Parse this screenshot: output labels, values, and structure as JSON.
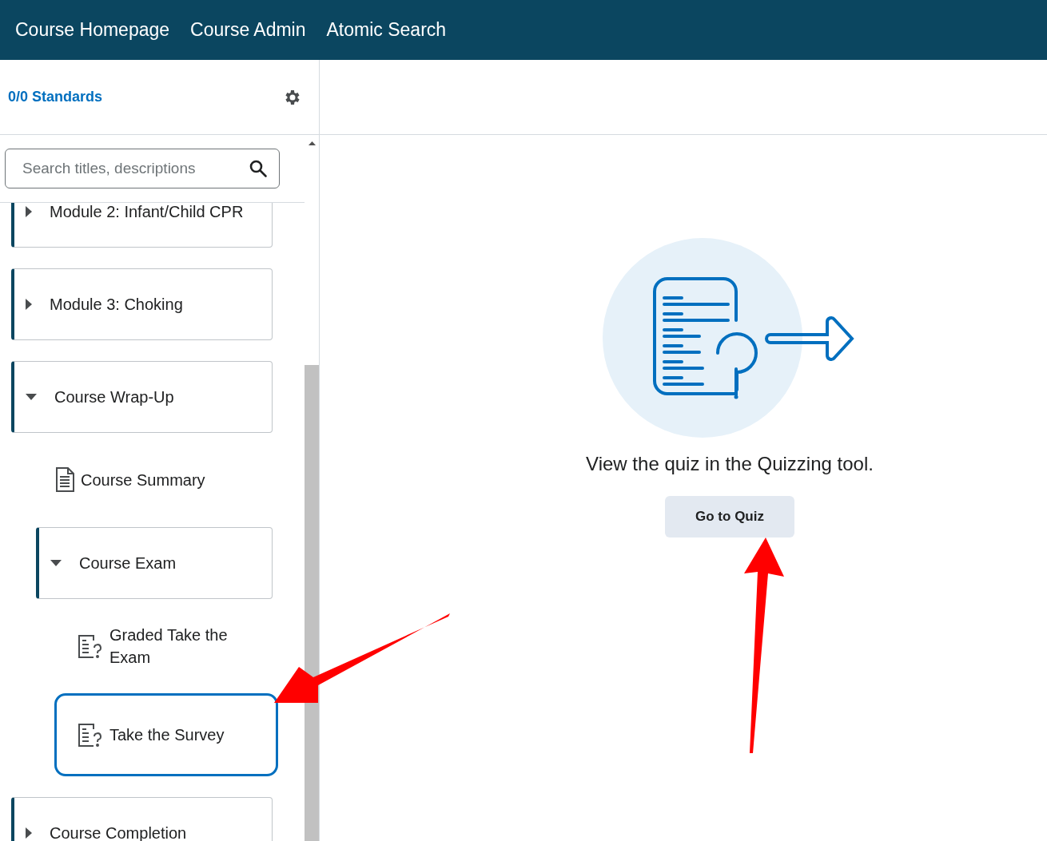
{
  "nav": [
    {
      "label": "Course Homepage"
    },
    {
      "label": "Course Admin"
    },
    {
      "label": "Atomic Search"
    }
  ],
  "sidebar": {
    "standards_link": "0/0 Standards",
    "search": {
      "placeholder": "Search titles, descriptions"
    },
    "tree": [
      {
        "kind": "module",
        "label": "Module 2: Infant/Child CPR",
        "expanded": false
      },
      {
        "kind": "module",
        "label": "Module 3: Choking",
        "expanded": false
      },
      {
        "kind": "module",
        "label": "Course Wrap-Up",
        "expanded": true,
        "children": [
          {
            "kind": "document",
            "label": "Course Summary",
            "selected": false
          },
          {
            "kind": "module",
            "label": "Course Exam",
            "expanded": true,
            "children": [
              {
                "kind": "quiz",
                "label": "Graded Take the Exam",
                "selected": false
              },
              {
                "kind": "quiz",
                "label": "Take the Survey",
                "selected": true
              }
            ]
          }
        ]
      },
      {
        "kind": "module",
        "label": "Course Completion",
        "expanded": false
      }
    ]
  },
  "main": {
    "message": "View the quiz in the Quizzing tool.",
    "button": "Go to Quiz"
  }
}
